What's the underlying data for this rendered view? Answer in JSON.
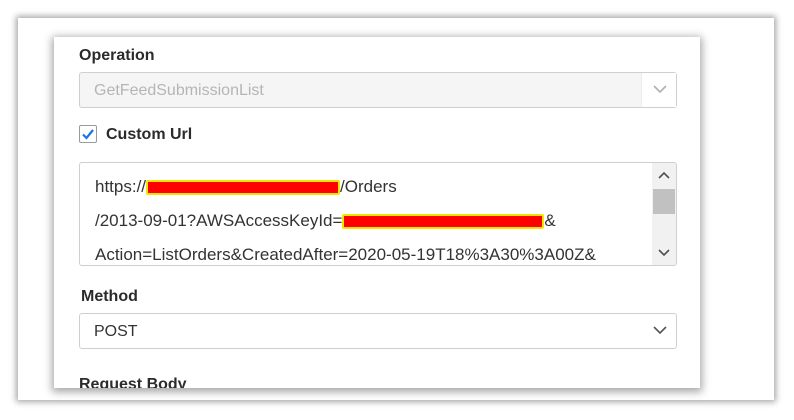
{
  "operation": {
    "label": "Operation",
    "value": "GetFeedSubmissionList"
  },
  "custom_url": {
    "label": "Custom Url",
    "checked": true,
    "lines": [
      {
        "prefix": "https://",
        "suffix": "/Orders"
      },
      {
        "prefix": "/2013-09-01?AWSAccessKeyId=",
        "suffix": "&"
      },
      {
        "prefix": "Action=ListOrders&CreatedAfter=2020-05-19T18%3A30%3A00Z&",
        "suffix": ""
      }
    ]
  },
  "method": {
    "label": "Method",
    "value": "POST"
  },
  "request_body": {
    "label": "Request Body"
  },
  "icons": {
    "chevron": "chevron-down-icon",
    "check": "checkmark-icon",
    "scroll_up": "scroll-up-arrow-icon",
    "scroll_down": "scroll-down-arrow-icon"
  },
  "colors": {
    "checkmark": "#1a73e8",
    "redaction_fill": "#ff0000",
    "redaction_border": "#f2e600"
  }
}
